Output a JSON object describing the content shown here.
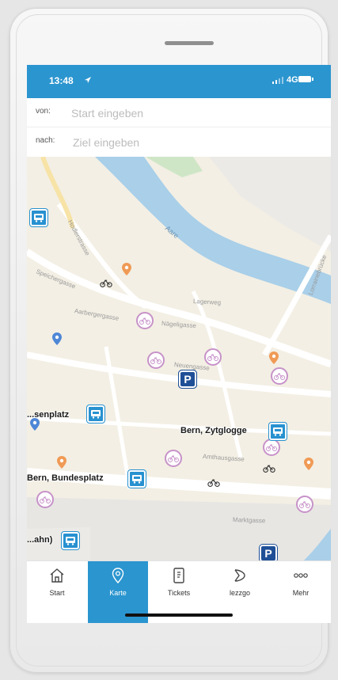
{
  "status_bar": {
    "time": "13:48",
    "network": "4G"
  },
  "search": {
    "from_label": "von:",
    "from_placeholder": "Start eingeben",
    "to_label": "nach:",
    "to_placeholder": "Ziel eingeben"
  },
  "map": {
    "river_label": "Aare",
    "streets": [
      "Hodlerstrasse",
      "Speichergasse",
      "Aarbergergasse",
      "Nägeligasse",
      "Neuengasse",
      "Amthausgasse",
      "Marktgasse",
      "Lorrainebrücke",
      "Lagerweg"
    ],
    "stops": [
      {
        "label": "Bern, Zytglogge"
      },
      {
        "label": "Bern, Bundesplatz"
      },
      {
        "label": "...senplatz"
      },
      {
        "label": "...ahn)"
      }
    ],
    "parking_symbol": "P"
  },
  "tabs": [
    {
      "label": "Start",
      "icon": "home-icon"
    },
    {
      "label": "Karte",
      "icon": "map-pin-icon"
    },
    {
      "label": "Tickets",
      "icon": "ticket-icon"
    },
    {
      "label": "lezzgo",
      "icon": "lezzgo-icon"
    },
    {
      "label": "Mehr",
      "icon": "more-icon"
    }
  ],
  "colors": {
    "accent": "#2b95cf",
    "river": "#a9cfe9",
    "parking": "#1f4f96",
    "bike_station": "#c792c9"
  }
}
